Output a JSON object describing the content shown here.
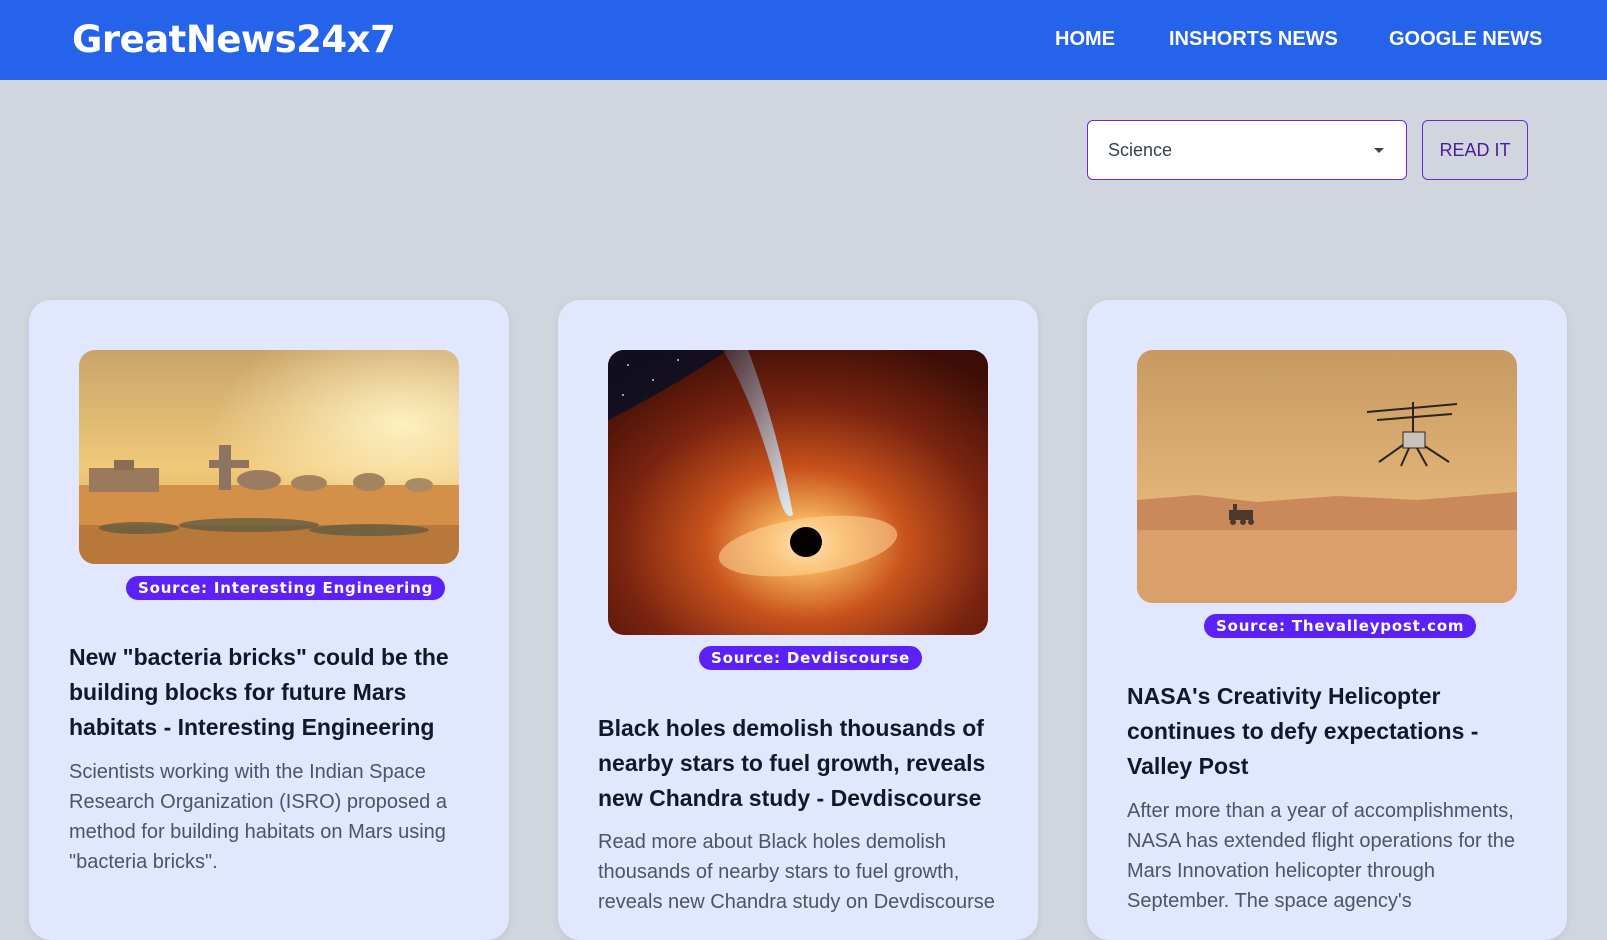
{
  "nav": {
    "brand": "GreatNews24x7",
    "links": [
      "HOME",
      "INSHORTS NEWS",
      "GOOGLE NEWS"
    ]
  },
  "controls": {
    "category_selected": "Science",
    "read_button": "READ IT"
  },
  "cards": [
    {
      "image": "mars-habitat-image",
      "source": "Source: Interesting Engineering",
      "title": "New \"bacteria bricks\" could be the building blocks for future Mars habitats - Interesting Engineering",
      "description": "Scientists working with the Indian Space Research Organization (ISRO) proposed a method for building habitats on Mars using \"bacteria bricks\"."
    },
    {
      "image": "black-hole-image",
      "source": "Source: Devdiscourse",
      "title": "Black holes demolish thousands of nearby stars to fuel growth, reveals new Chandra study - Devdiscourse",
      "description": "Read more about Black holes demolish thousands of nearby stars to fuel growth, reveals new Chandra study on Devdiscourse"
    },
    {
      "image": "mars-helicopter-image",
      "source": "Source: Thevalleypost.com",
      "title": "NASA's Creativity Helicopter continues to defy expectations - Valley Post",
      "description": "After more than a year of accomplishments, NASA has extended flight operations for the Mars Innovation helicopter through September. The space agency's"
    }
  ],
  "colors": {
    "navbar": "#2563eb",
    "background": "#d1d5de",
    "card": "#e0e7ff",
    "badge": "#5b21f6",
    "accent_border": "#6d28d9"
  }
}
